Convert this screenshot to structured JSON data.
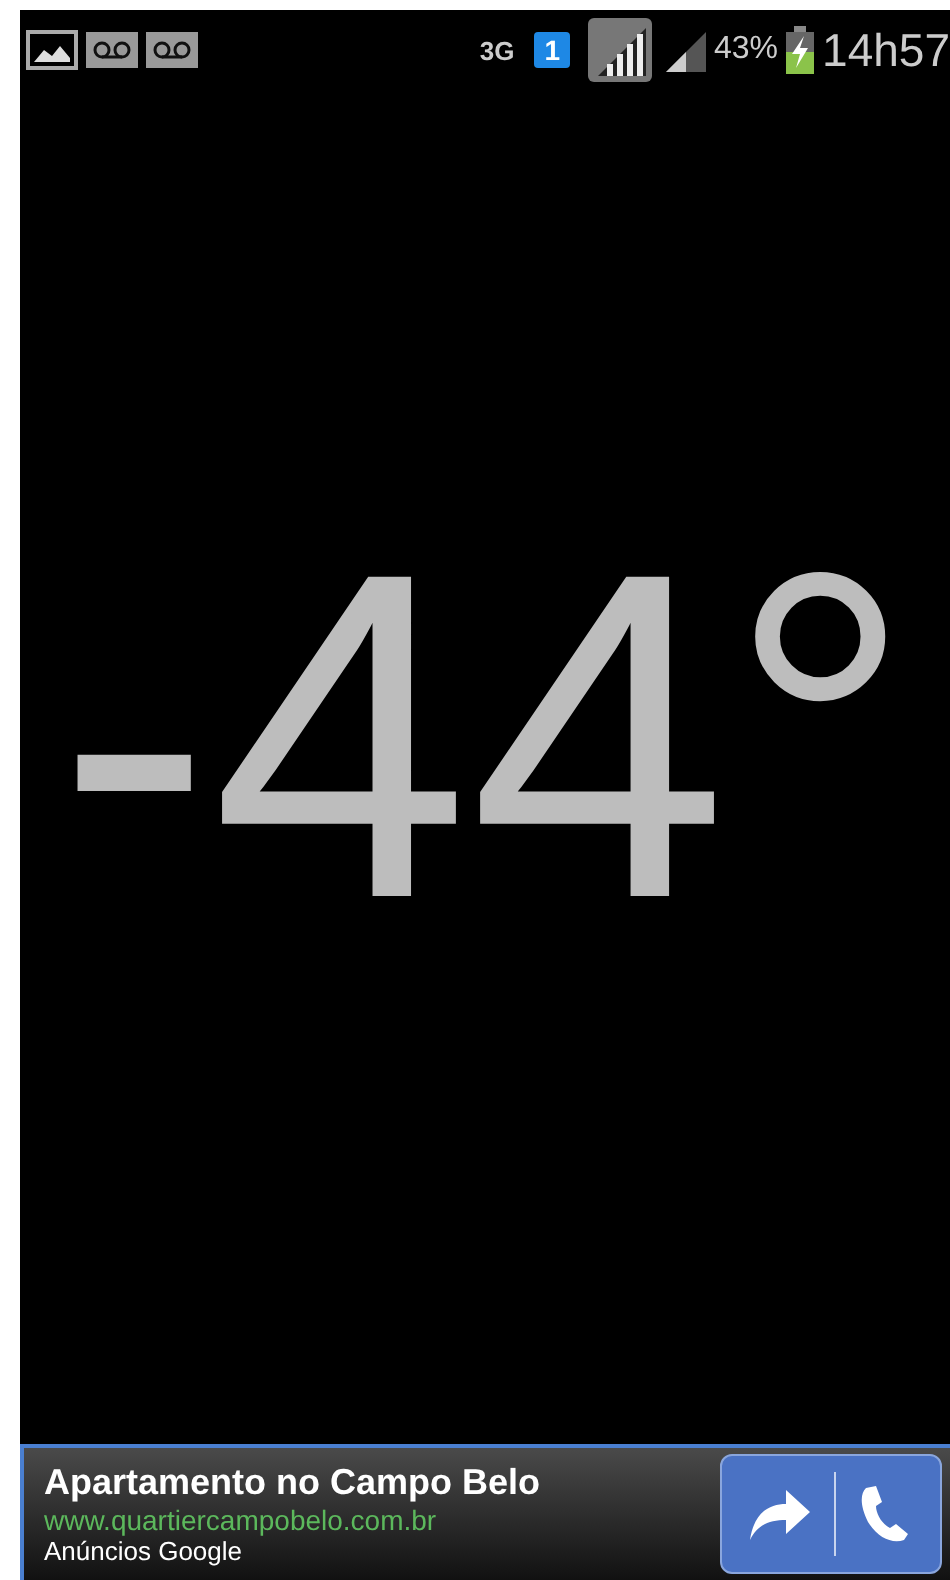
{
  "status_bar": {
    "network": "3G",
    "sim": "1",
    "battery": "43%",
    "time": "14h57"
  },
  "reading": "-44°",
  "ad": {
    "title": "Apartamento no Campo Belo",
    "url": "www.quartiercampobelo.com.br",
    "source": "Anúncios Google"
  }
}
